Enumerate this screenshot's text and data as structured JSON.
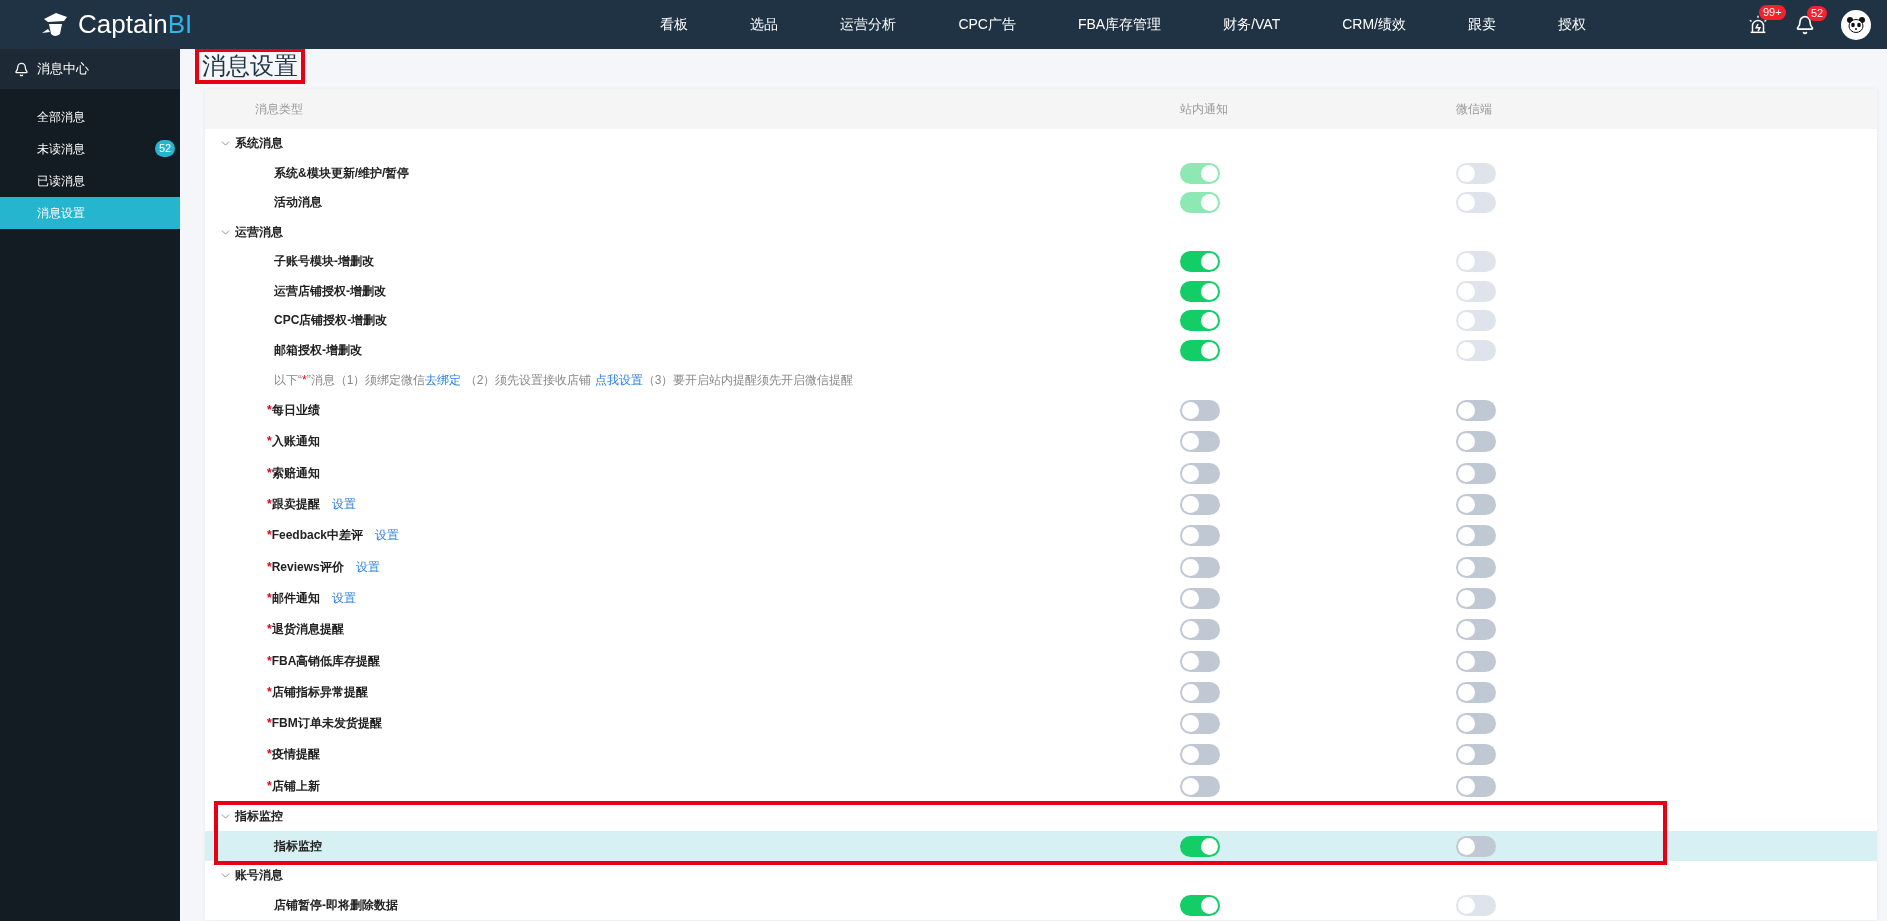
{
  "topbar": {
    "logo": {
      "name": "Captain",
      "suffix": "BI"
    },
    "nav": [
      "看板",
      "选品",
      "运营分析",
      "CPC广告",
      "FBA库存管理",
      "财务/VAT",
      "CRM/绩效",
      "跟卖",
      "授权"
    ],
    "alert_badge": "99+",
    "bell_badge": "52"
  },
  "sidebar": {
    "title": "消息中心",
    "items": [
      {
        "label": "全部消息",
        "selected": false
      },
      {
        "label": "未读消息",
        "badge": "52",
        "selected": false
      },
      {
        "label": "已读消息",
        "selected": false
      },
      {
        "label": "消息设置",
        "selected": true
      }
    ]
  },
  "page_title": {
    "text": "消息设置",
    "highlighted": true
  },
  "table": {
    "columns": [
      "消息类型",
      "站内通知",
      "微信端"
    ],
    "groups": [
      {
        "title": "系统消息",
        "expanded": true,
        "highlighted": false,
        "items": [
          {
            "kind": "item",
            "label": "系统&模块更新/维护/暂停",
            "required": false,
            "selected": false,
            "station": {
              "on": true,
              "disabled": true
            },
            "wechat": {
              "on": false,
              "disabled": true
            }
          },
          {
            "kind": "item",
            "label": "活动消息",
            "required": false,
            "selected": false,
            "station": {
              "on": true,
              "disabled": true
            },
            "wechat": {
              "on": false,
              "disabled": true
            }
          }
        ]
      },
      {
        "title": "运营消息",
        "expanded": true,
        "highlighted": false,
        "items": [
          {
            "kind": "item",
            "label": "子账号模块-增删改",
            "required": false,
            "selected": false,
            "station": {
              "on": true,
              "disabled": false
            },
            "wechat": {
              "on": false,
              "disabled": true
            }
          },
          {
            "kind": "item",
            "label": "运营店铺授权-增删改",
            "required": false,
            "selected": false,
            "station": {
              "on": true,
              "disabled": false
            },
            "wechat": {
              "on": false,
              "disabled": true
            }
          },
          {
            "kind": "item",
            "label": "CPC店铺授权-增删改",
            "required": false,
            "selected": false,
            "station": {
              "on": true,
              "disabled": false
            },
            "wechat": {
              "on": false,
              "disabled": true
            }
          },
          {
            "kind": "item",
            "label": "邮箱授权-增删改",
            "required": false,
            "selected": false,
            "station": {
              "on": true,
              "disabled": false
            },
            "wechat": {
              "on": false,
              "disabled": true
            }
          },
          {
            "kind": "notice",
            "parts": [
              {
                "kind": "text",
                "text": "以下“"
              },
              {
                "kind": "mark",
                "text": "*"
              },
              {
                "kind": "text",
                "text": "”消息（1）须绑定微信"
              },
              {
                "kind": "link",
                "text": "去绑定"
              },
              {
                "kind": "text",
                "text": " （2）须先设置接收店铺 "
              },
              {
                "kind": "link",
                "text": "点我设置"
              },
              {
                "kind": "text",
                "text": "（3）要开启站内提醒须先开启微信提醒"
              }
            ]
          },
          {
            "kind": "item",
            "label": "每日业绩",
            "required": true,
            "selected": false,
            "station": {
              "on": false,
              "disabled": false
            },
            "wechat": {
              "on": false,
              "disabled": false
            }
          },
          {
            "kind": "item",
            "label": "入账通知",
            "required": true,
            "selected": false,
            "station": {
              "on": false,
              "disabled": false
            },
            "wechat": {
              "on": false,
              "disabled": false
            }
          },
          {
            "kind": "item",
            "label": "索赔通知",
            "required": true,
            "selected": false,
            "station": {
              "on": false,
              "disabled": false
            },
            "wechat": {
              "on": false,
              "disabled": false
            }
          },
          {
            "kind": "item",
            "label": "跟卖提醒",
            "required": true,
            "link": "设置",
            "selected": false,
            "station": {
              "on": false,
              "disabled": false
            },
            "wechat": {
              "on": false,
              "disabled": false
            }
          },
          {
            "kind": "item",
            "label": "Feedback中差评",
            "required": true,
            "link": "设置",
            "selected": false,
            "station": {
              "on": false,
              "disabled": false
            },
            "wechat": {
              "on": false,
              "disabled": false
            }
          },
          {
            "kind": "item",
            "label": "Reviews评价",
            "required": true,
            "link": "设置",
            "selected": false,
            "station": {
              "on": false,
              "disabled": false
            },
            "wechat": {
              "on": false,
              "disabled": false
            }
          },
          {
            "kind": "item",
            "label": "邮件通知",
            "required": true,
            "link": "设置",
            "selected": false,
            "station": {
              "on": false,
              "disabled": false
            },
            "wechat": {
              "on": false,
              "disabled": false
            }
          },
          {
            "kind": "item",
            "label": "退货消息提醒",
            "required": true,
            "selected": false,
            "station": {
              "on": false,
              "disabled": false
            },
            "wechat": {
              "on": false,
              "disabled": false
            }
          },
          {
            "kind": "item",
            "label": "FBA高销低库存提醒",
            "required": true,
            "selected": false,
            "station": {
              "on": false,
              "disabled": false
            },
            "wechat": {
              "on": false,
              "disabled": false
            }
          },
          {
            "kind": "item",
            "label": "店铺指标异常提醒",
            "required": true,
            "selected": false,
            "station": {
              "on": false,
              "disabled": false
            },
            "wechat": {
              "on": false,
              "disabled": false
            }
          },
          {
            "kind": "item",
            "label": "FBM订单未发货提醒",
            "required": true,
            "selected": false,
            "station": {
              "on": false,
              "disabled": false
            },
            "wechat": {
              "on": false,
              "disabled": false
            }
          },
          {
            "kind": "item",
            "label": "疫情提醒",
            "required": true,
            "selected": false,
            "station": {
              "on": false,
              "disabled": false
            },
            "wechat": {
              "on": false,
              "disabled": false
            }
          },
          {
            "kind": "item",
            "label": "店铺上新",
            "required": true,
            "selected": false,
            "station": {
              "on": false,
              "disabled": false
            },
            "wechat": {
              "on": false,
              "disabled": false
            }
          }
        ]
      },
      {
        "title": "指标监控",
        "expanded": true,
        "highlighted": true,
        "items": [
          {
            "kind": "item",
            "label": "指标监控",
            "required": false,
            "selected": true,
            "station": {
              "on": true,
              "disabled": false
            },
            "wechat": {
              "on": false,
              "disabled": false
            }
          }
        ]
      },
      {
        "title": "账号消息",
        "expanded": true,
        "highlighted": false,
        "items": [
          {
            "kind": "item",
            "label": "店铺暂停-即将删除数据",
            "required": false,
            "selected": false,
            "station": {
              "on": true,
              "disabled": false
            },
            "wechat": {
              "on": false,
              "disabled": true
            }
          }
        ]
      }
    ]
  }
}
